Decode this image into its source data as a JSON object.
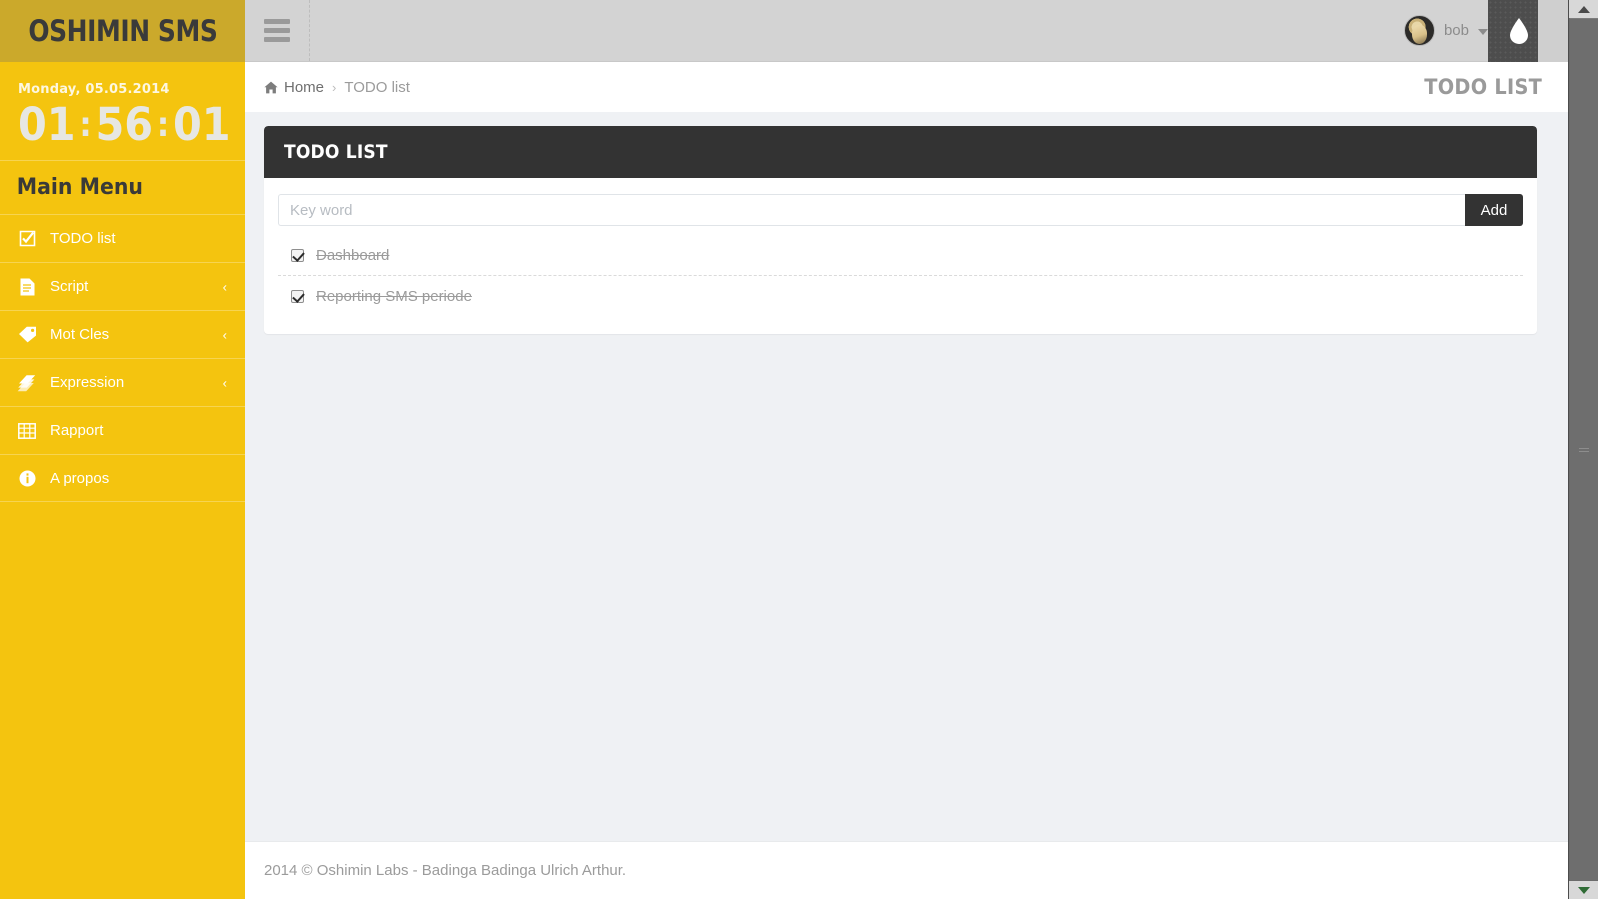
{
  "header": {
    "logo": "OSHIMIN SMS",
    "toggle_icon": "hamburger-icon",
    "user_name": "bob",
    "drop_button_icon": "water-drop-icon"
  },
  "sidebar": {
    "clock": {
      "date": "Monday, 05.05.2014",
      "hours": "01",
      "minutes": "56",
      "seconds": "01",
      "separator": ":"
    },
    "menu_title": "Main Menu",
    "items": [
      {
        "label": "TODO list",
        "icon": "check-square-icon",
        "has_arrow": false,
        "arrow": ""
      },
      {
        "label": "Script",
        "icon": "file-icon",
        "has_arrow": true,
        "arrow": "‹"
      },
      {
        "label": "Mot Cles",
        "icon": "tag-icon",
        "has_arrow": true,
        "arrow": "‹"
      },
      {
        "label": "Expression",
        "icon": "tags-icon",
        "has_arrow": true,
        "arrow": "‹"
      },
      {
        "label": "Rapport",
        "icon": "table-icon",
        "has_arrow": false,
        "arrow": ""
      },
      {
        "label": "A propos",
        "icon": "info-circle-icon",
        "has_arrow": false,
        "arrow": ""
      }
    ]
  },
  "breadcrumb": {
    "home_icon": "home-icon",
    "home": "Home",
    "separator": "›",
    "current": "TODO list"
  },
  "page_title": "TODO LIST",
  "panel": {
    "title": "TODO LIST",
    "input_placeholder": "Key word",
    "input_value": "",
    "add_label": "Add",
    "items": [
      {
        "label": "Dashboard",
        "checked": true,
        "done": true
      },
      {
        "label": "Reporting SMS periode",
        "checked": true,
        "done": true
      }
    ]
  },
  "footer": {
    "text": "2014 © Oshimin Labs - Badinga Badinga Ulrich Arthur."
  },
  "colors": {
    "brand_yellow": "#f4c40f",
    "logo_gold": "#cba92b",
    "panel_dark": "#333333",
    "content_bg": "#eff1f4",
    "muted_text": "#9b9b9b"
  }
}
